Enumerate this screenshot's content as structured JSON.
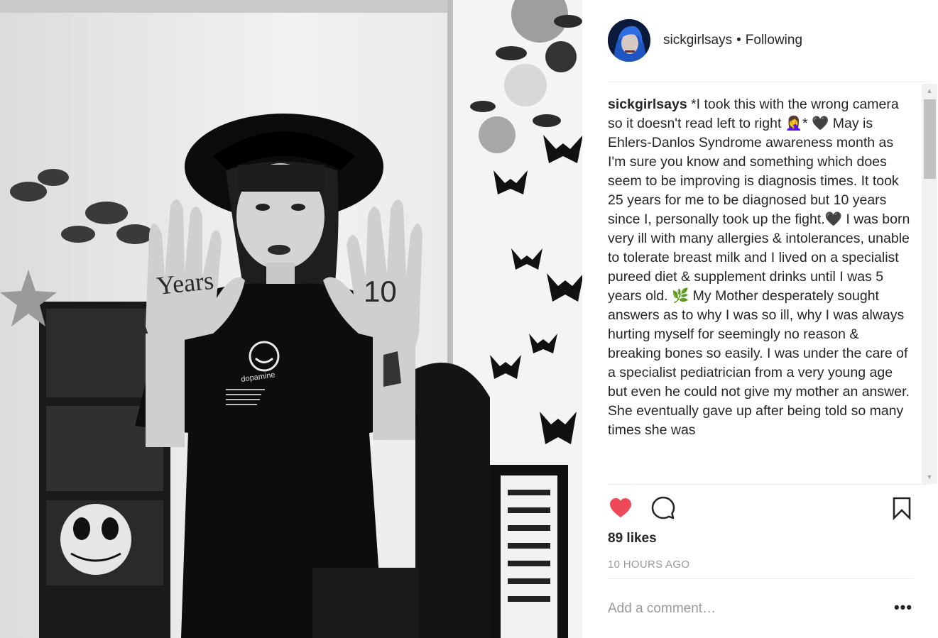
{
  "post": {
    "username": "sickgirlsays",
    "separator": "•",
    "follow_status": "Following",
    "caption_text": "*I took this with the wrong camera so it doesn't read left to right 🤦‍♀️* 🖤 May is Ehlers-Danlos Syndrome awareness month as I'm sure you know and something which does seem to be improving is diagnosis times. It took 25 years for me to be diagnosed but 10 years since I, personally took up the fight.🖤 I was born very ill with many allergies & intolerances, unable to tolerate breast milk and I lived on a specialist pureed diet & supplement drinks until I was 5 years old. 🌿 My Mother desperately sought answers as to why I was so ill, why I was always hurting myself for seemingly no reason & breaking bones so easily. I was under the care of a specialist pediatrician from a very young age but even he could not give my mother an answer. She eventually gave up after being told so many times she was",
    "likes": "89 likes",
    "time_ago": "10 HOURS AGO",
    "comment_placeholder": "Add a comment…",
    "more_options": "•••"
  },
  "photo": {
    "hand_text_left": "Years",
    "hand_text_right": "10",
    "shirt_text": "dopamine"
  },
  "icons": {
    "like": "heart-icon",
    "comment": "comment-icon",
    "save": "bookmark-icon",
    "more": "more-options-icon"
  },
  "colors": {
    "like_active": "#ed4956",
    "text": "#262626",
    "muted": "#999999",
    "divider": "#efefef"
  }
}
